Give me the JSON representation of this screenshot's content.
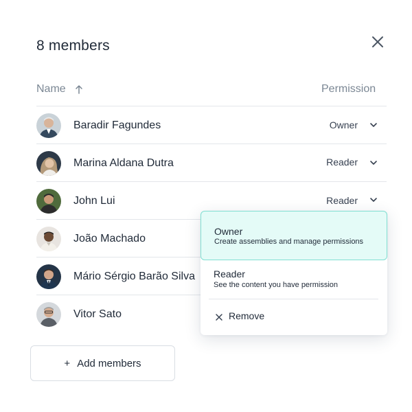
{
  "dialog": {
    "title": "8 members",
    "close_icon": "close-icon"
  },
  "table": {
    "headers": {
      "name": "Name",
      "permission": "Permission"
    },
    "sort_icon": "arrow-up-icon",
    "members": [
      {
        "name": "Baradir Fagundes",
        "permission": "Owner",
        "avatar_bg": "#c9d2d8"
      },
      {
        "name": "Marina Aldana Dutra",
        "permission": "Reader",
        "avatar_bg": "#2e3a48"
      },
      {
        "name": "John Lui",
        "permission": "Reader",
        "avatar_bg": "#4f6b3c"
      },
      {
        "name": "João Machado",
        "permission": "",
        "avatar_bg": "#e8e4e0"
      },
      {
        "name": "Mário Sérgio Barão Silva",
        "permission": "",
        "avatar_bg": "#243447"
      },
      {
        "name": "Vitor Sato",
        "permission": "",
        "avatar_bg": "#d4d8dc"
      }
    ]
  },
  "actions": {
    "add_members": "Add members",
    "add_symbol": "+"
  },
  "permission_menu": {
    "options": [
      {
        "title": "Owner",
        "description": "Create assemblies and manage permissions",
        "selected": true
      },
      {
        "title": "Reader",
        "description": "See the content you have permission",
        "selected": false
      }
    ],
    "remove_label": "Remove"
  },
  "colors": {
    "selected_bg": "#e4fbf7",
    "selected_border": "#7fded1",
    "muted_text": "#7b8794"
  }
}
